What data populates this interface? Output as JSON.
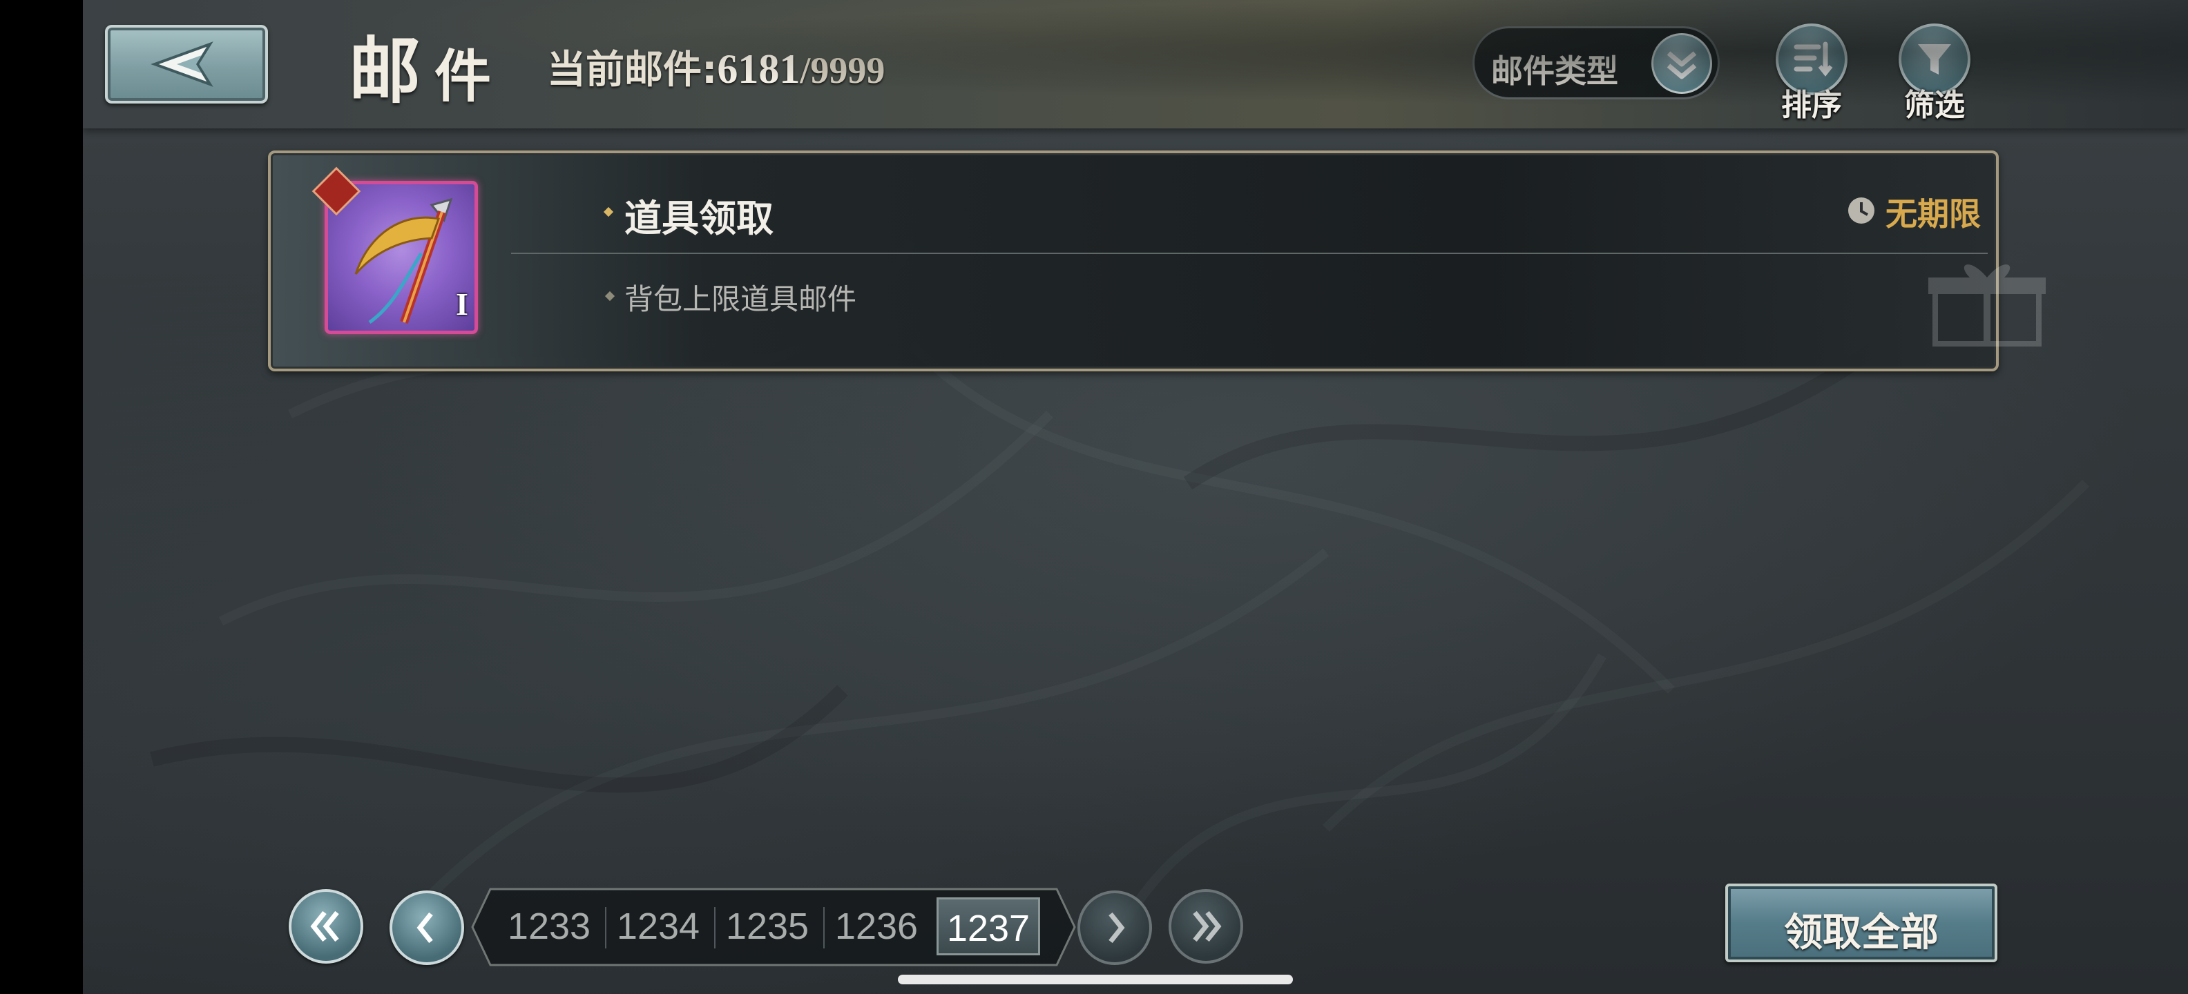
{
  "header": {
    "title_char1": "邮",
    "title_char2": "件",
    "count_label": "当前邮件:",
    "count_current": "6181",
    "count_max": "/9999",
    "type_select_label": "邮件类型",
    "sort_label": "排序",
    "filter_label": "筛选"
  },
  "mail_list": [
    {
      "title": "道具领取",
      "subtitle": "背包上限道具邮件",
      "expiry": "无期限",
      "item_level": "I",
      "item_rarity_color": "#d54b96"
    }
  ],
  "pagination": {
    "pages": [
      "1233",
      "1234",
      "1235",
      "1236",
      "1237"
    ],
    "current": "1237"
  },
  "footer": {
    "claim_all_label": "领取全部"
  },
  "colors": {
    "expiry_gold": "#d9a94d",
    "card_border": "#a59a7f",
    "button_teal": "#557c89"
  },
  "icons": {
    "back": "back-arrow-icon",
    "type_dropdown": "chevron-double-down-icon",
    "sort": "sort-icon",
    "filter": "filter-funnel-icon",
    "clock": "clock-icon",
    "gift": "gift-icon",
    "first_page": "double-chevron-left-icon",
    "prev_page": "chevron-left-icon",
    "next_page": "chevron-right-icon",
    "last_page": "double-chevron-right-icon"
  }
}
